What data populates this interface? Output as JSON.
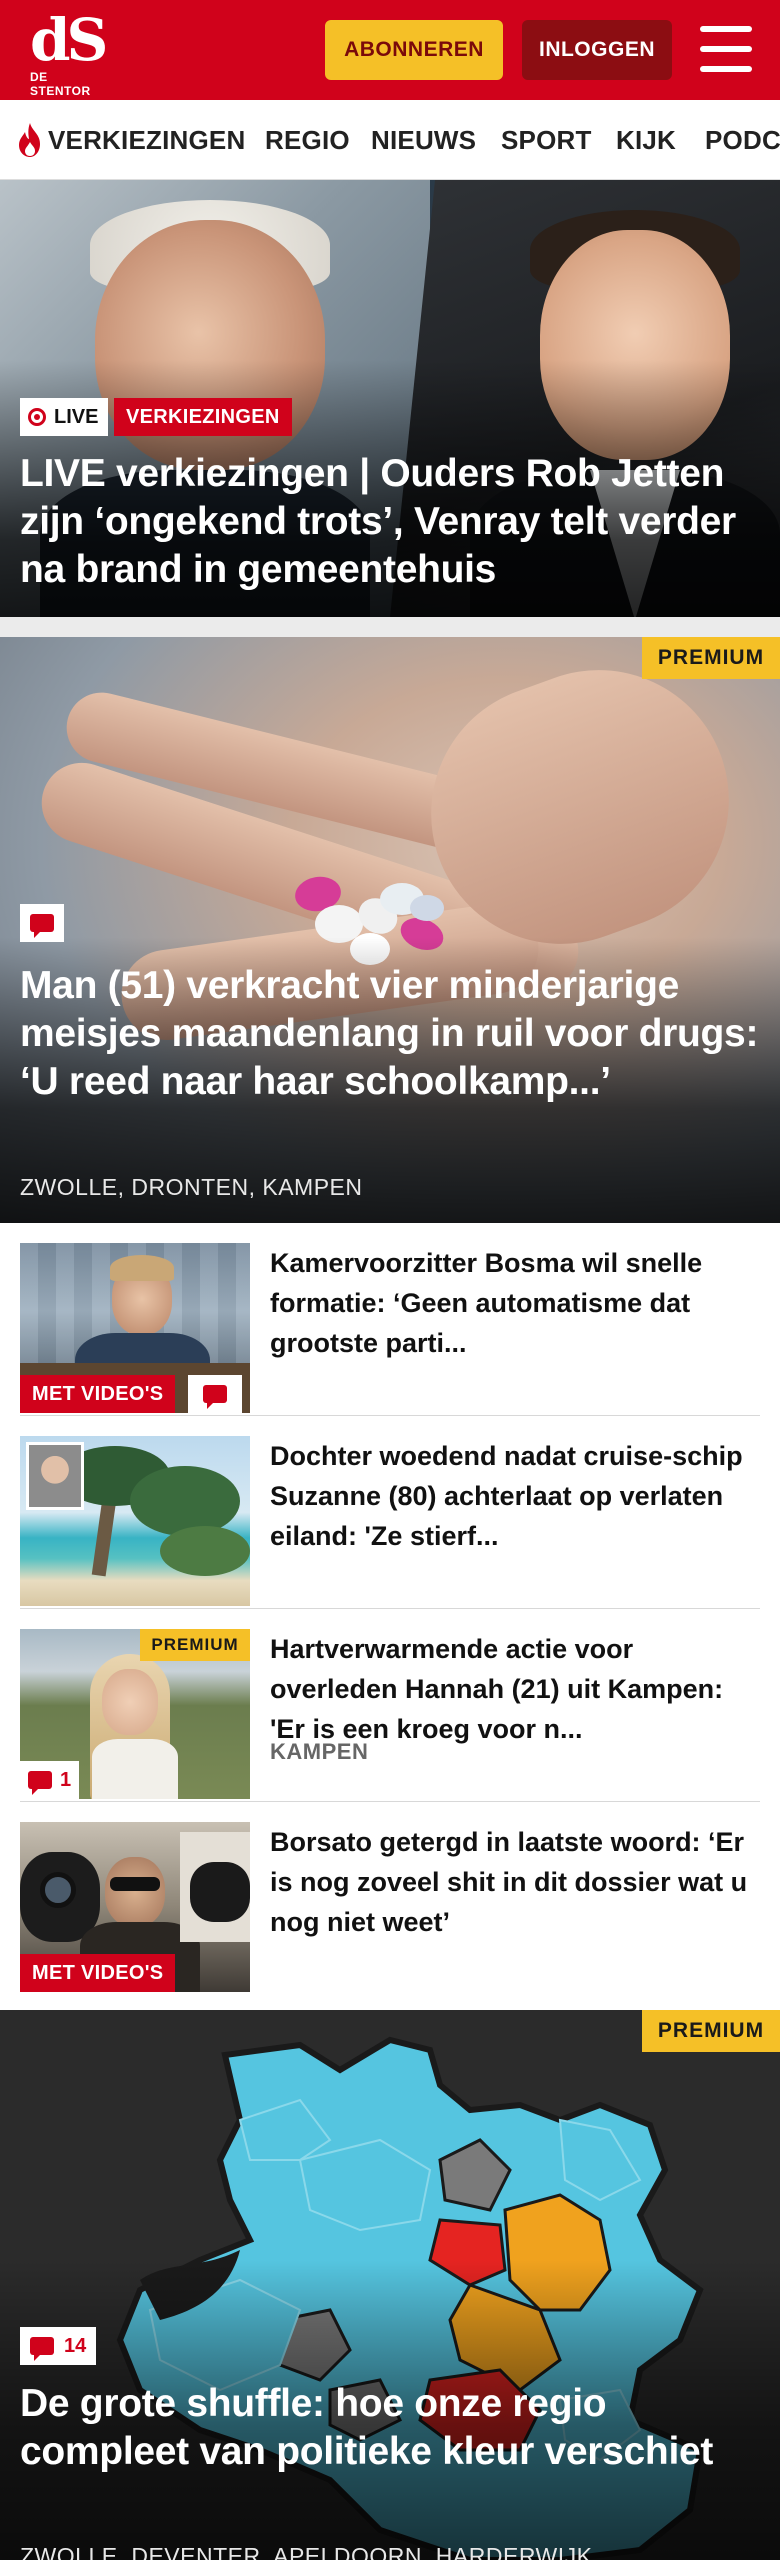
{
  "header": {
    "logo_mark": "dS",
    "logo_name": "DE STENTOR",
    "subscribe_label": "ABONNEREN",
    "login_label": "INLOGGEN",
    "brand_color": "#d0021b",
    "accent_color": "#f5c027"
  },
  "nav": {
    "items": [
      {
        "label": "VERKIEZINGEN",
        "icon": "flame-icon"
      },
      {
        "label": "REGIO"
      },
      {
        "label": "NIEUWS"
      },
      {
        "label": "SPORT"
      },
      {
        "label": "KIJK"
      },
      {
        "label": "PODC"
      }
    ]
  },
  "hero": {
    "live_label": "LIVE",
    "category": "VERKIEZINGEN",
    "title": "LIVE verkiezingen | Ouders Rob Jetten zijn ‘ongekend trots’, Venray telt verder na brand in gemeentehuis"
  },
  "feature": {
    "premium_label": "PREMIUM",
    "title": "Man (51) verkracht vier minderjarige meisjes maandenlang in ruil voor drugs: ‘U reed naar haar schoolkamp...’",
    "location": "ZWOLLE, DRONTEN, KAMPEN"
  },
  "articles": [
    {
      "title": "Kamervoorzitter Bosma wil snelle formatie: ‘Geen automatisme dat grootste parti...",
      "video_label": "MET VIDEO'S",
      "has_comment": true
    },
    {
      "title": "Dochter woedend nadat cruise-schip Suzanne (80) achterlaat op verlaten eiland: 'Ze stierf..."
    },
    {
      "title": "Hartverwarmende actie voor overleden Hannah (21) uit Kampen: 'Er is een kroeg voor n...",
      "premium_label": "PREMIUM",
      "comment_count": "1",
      "location": "KAMPEN"
    },
    {
      "title": "Borsato getergd in laatste woord: ‘Er is nog zoveel shit in dit dossier wat u nog niet weet’",
      "video_label": "MET VIDEO'S"
    }
  ],
  "map_story": {
    "premium_label": "PREMIUM",
    "comment_count": "14",
    "title": "De grote shuffle: hoe onze regio compleet van politieke kleur verschiet",
    "location": "ZWOLLE, DEVENTER, APELDOORN, HARDERWIJK"
  }
}
